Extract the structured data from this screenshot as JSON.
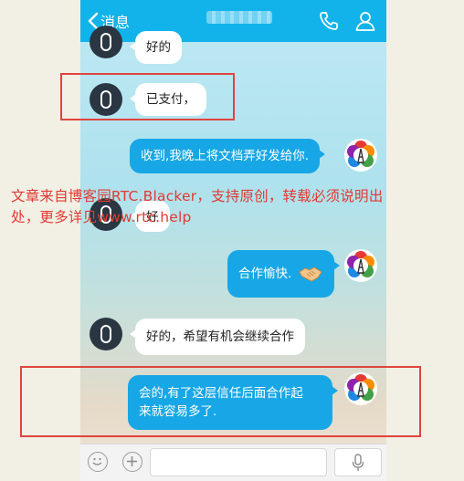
{
  "header": {
    "back_label": "消息"
  },
  "messages": [
    {
      "side": "in",
      "text": "好的"
    },
    {
      "side": "in",
      "text": "已支付，"
    },
    {
      "side": "out",
      "text": "收到,我晚上将文档弄好发给你."
    },
    {
      "side": "in",
      "text": "好"
    },
    {
      "side": "out",
      "text": "合作愉快."
    },
    {
      "side": "in",
      "text": "好的，希望有机会继续合作"
    },
    {
      "side": "out",
      "text_line1": "会的,有了这层信任后面合作起",
      "text_line2": "来就容易多了."
    }
  ],
  "input": {
    "value": "",
    "placeholder": ""
  },
  "watermark": {
    "line1": "文章来自博客园RTC.Blacker，支持原创，转载必须说明出",
    "line2": "处，更多详见www.rtc.help"
  },
  "colors": {
    "header": "#12b3ea",
    "bubble_out": "#18a7e6",
    "highlight_box": "#e0443e",
    "watermark": "#e23a33"
  },
  "icons": [
    "chevron-left-icon",
    "phone-icon",
    "user-icon",
    "emoji-icon",
    "plus-icon",
    "microphone-icon",
    "handshake-icon"
  ]
}
